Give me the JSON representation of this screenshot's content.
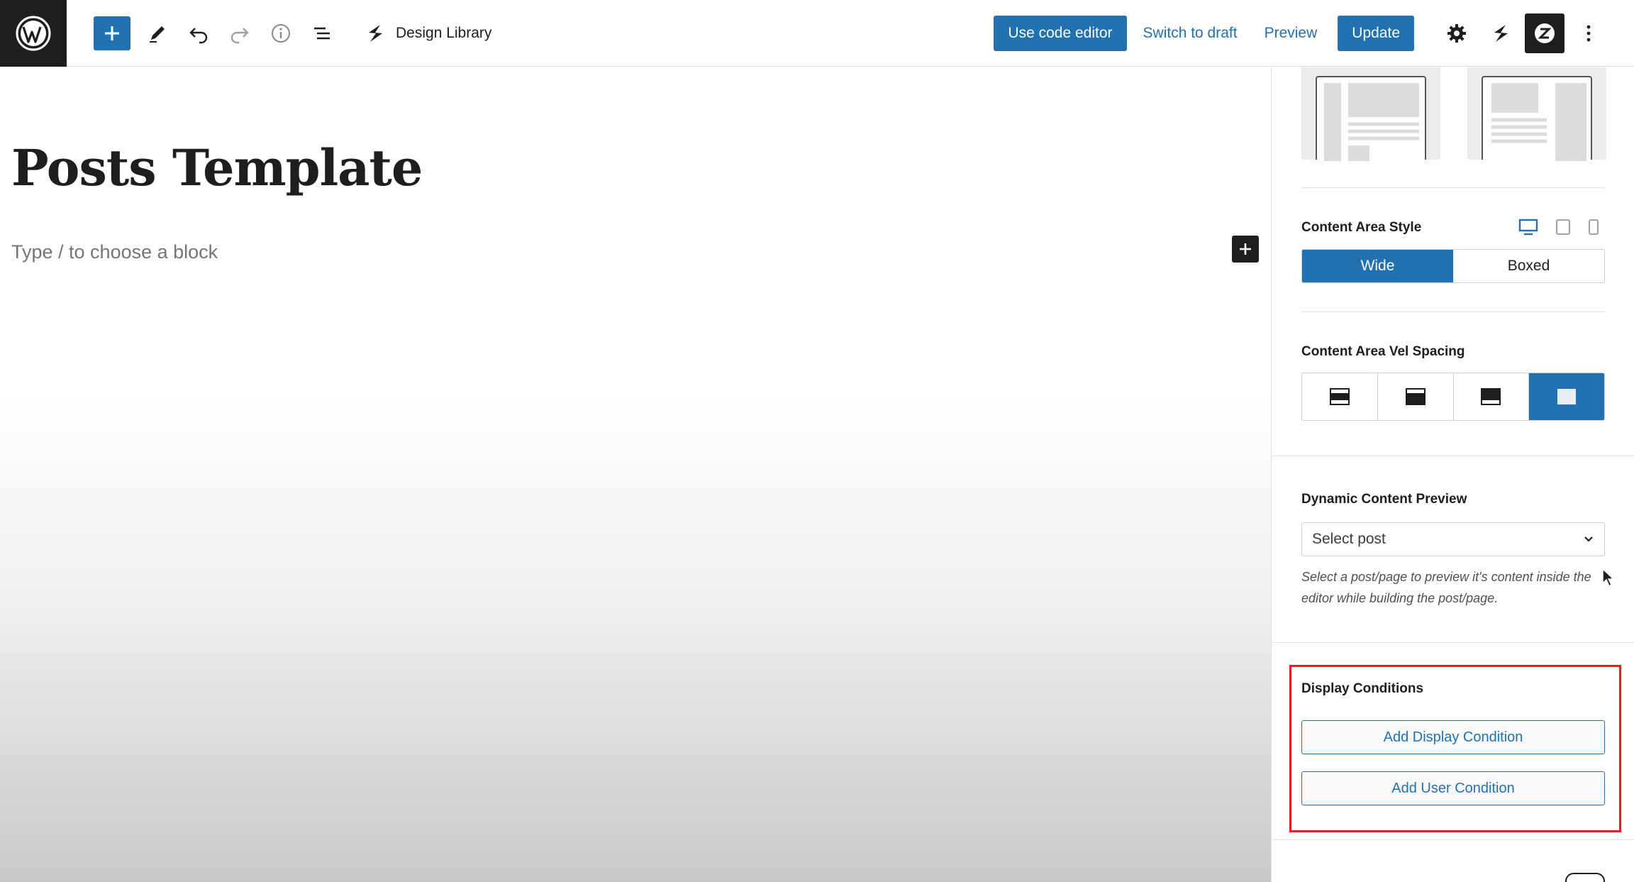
{
  "topbar": {
    "site_label": "Design Library",
    "use_code_editor": "Use code editor",
    "switch_to_draft": "Switch to draft",
    "preview": "Preview",
    "update": "Update",
    "icons": [
      "wordpress-logo-icon",
      "plus-icon",
      "pencil-icon",
      "undo-icon",
      "redo-icon",
      "info-icon",
      "list-view-icon",
      "brand-s-icon",
      "gear-icon",
      "brand-s-icon",
      "brand-z-icon",
      "more-vertical-icon"
    ]
  },
  "editor": {
    "title": "Posts Template",
    "placeholder": "Type / to choose a block"
  },
  "sidebar": {
    "content_area_style": {
      "label": "Content Area Style",
      "options": [
        "Wide",
        "Boxed"
      ],
      "selected": "Wide",
      "devices": [
        "desktop-icon",
        "tablet-icon",
        "mobile-icon"
      ]
    },
    "content_area_spacing": {
      "label": "Content Area Vel Spacing",
      "selected_index": 3
    },
    "dynamic_preview": {
      "label": "Dynamic Content Preview",
      "select_value": "Select post",
      "help": "Select a post/page to preview it's content inside the editor while building the post/page."
    },
    "display_conditions": {
      "label": "Display Conditions",
      "add_display": "Add Display Condition",
      "add_user": "Add User Condition"
    }
  },
  "colors": {
    "accent": "#2271b1",
    "dark": "#1e1e1e",
    "highlight": "#e3201b"
  }
}
